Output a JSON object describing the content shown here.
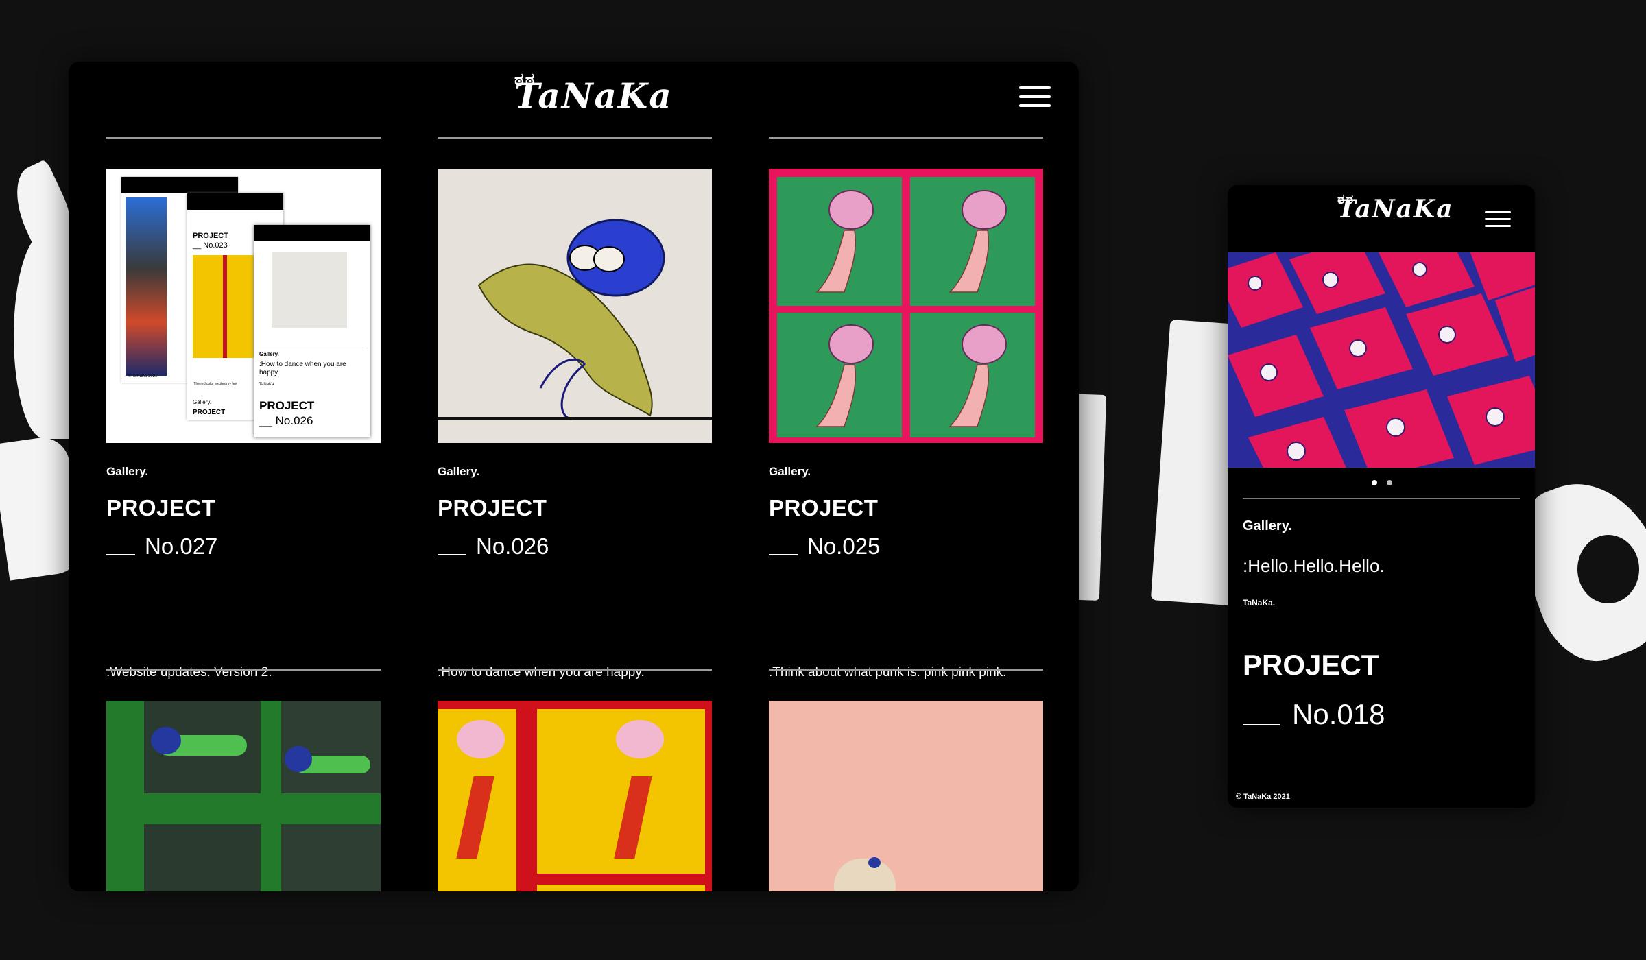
{
  "brand": {
    "logo_text": "TaNaKa",
    "logo_mark": "ಠಠ"
  },
  "desktop": {
    "cards": [
      {
        "category": "Gallery.",
        "project": "PROJECT",
        "number": "No.027",
        "description": ":Website updates. Version 2."
      },
      {
        "category": "Gallery.",
        "project": "PROJECT",
        "number": "No.026",
        "description": ":How to dance when you are happy."
      },
      {
        "category": "Gallery.",
        "project": "PROJECT",
        "number": "No.025",
        "description": ":Think about what punk is. pink pink pink."
      }
    ],
    "card027_mock": {
      "tile_a": {
        "project": "PROJECT",
        "number": "No.023",
        "category": "Gallery.",
        "caption": ":The red color excites my fee"
      },
      "tile_b": {
        "category": "Gallery.",
        "description": ":How to dance when you are happy.",
        "author": "TaNaKa",
        "project": "PROJECT",
        "number": "No.026"
      },
      "footer": "© TaNaKa 2021",
      "bottom_project": "PROJECT"
    }
  },
  "mobile": {
    "category": "Gallery.",
    "description": ":Hello.Hello.Hello.",
    "author": "TaNaKa.",
    "project": "PROJECT",
    "number": "No.018",
    "copyright": "© TaNaKa 2021",
    "carousel": {
      "total": 2,
      "active": 1
    }
  },
  "colors": {
    "page_bg": "#111111",
    "window_bg": "#000000",
    "rule": "#9a9a9a",
    "accent_pink": "#e8155e",
    "accent_green": "#1f9a55",
    "accent_blue": "#2b3fd0",
    "accent_yellow": "#f2c500"
  },
  "icons": [
    "hamburger-menu-icon"
  ]
}
